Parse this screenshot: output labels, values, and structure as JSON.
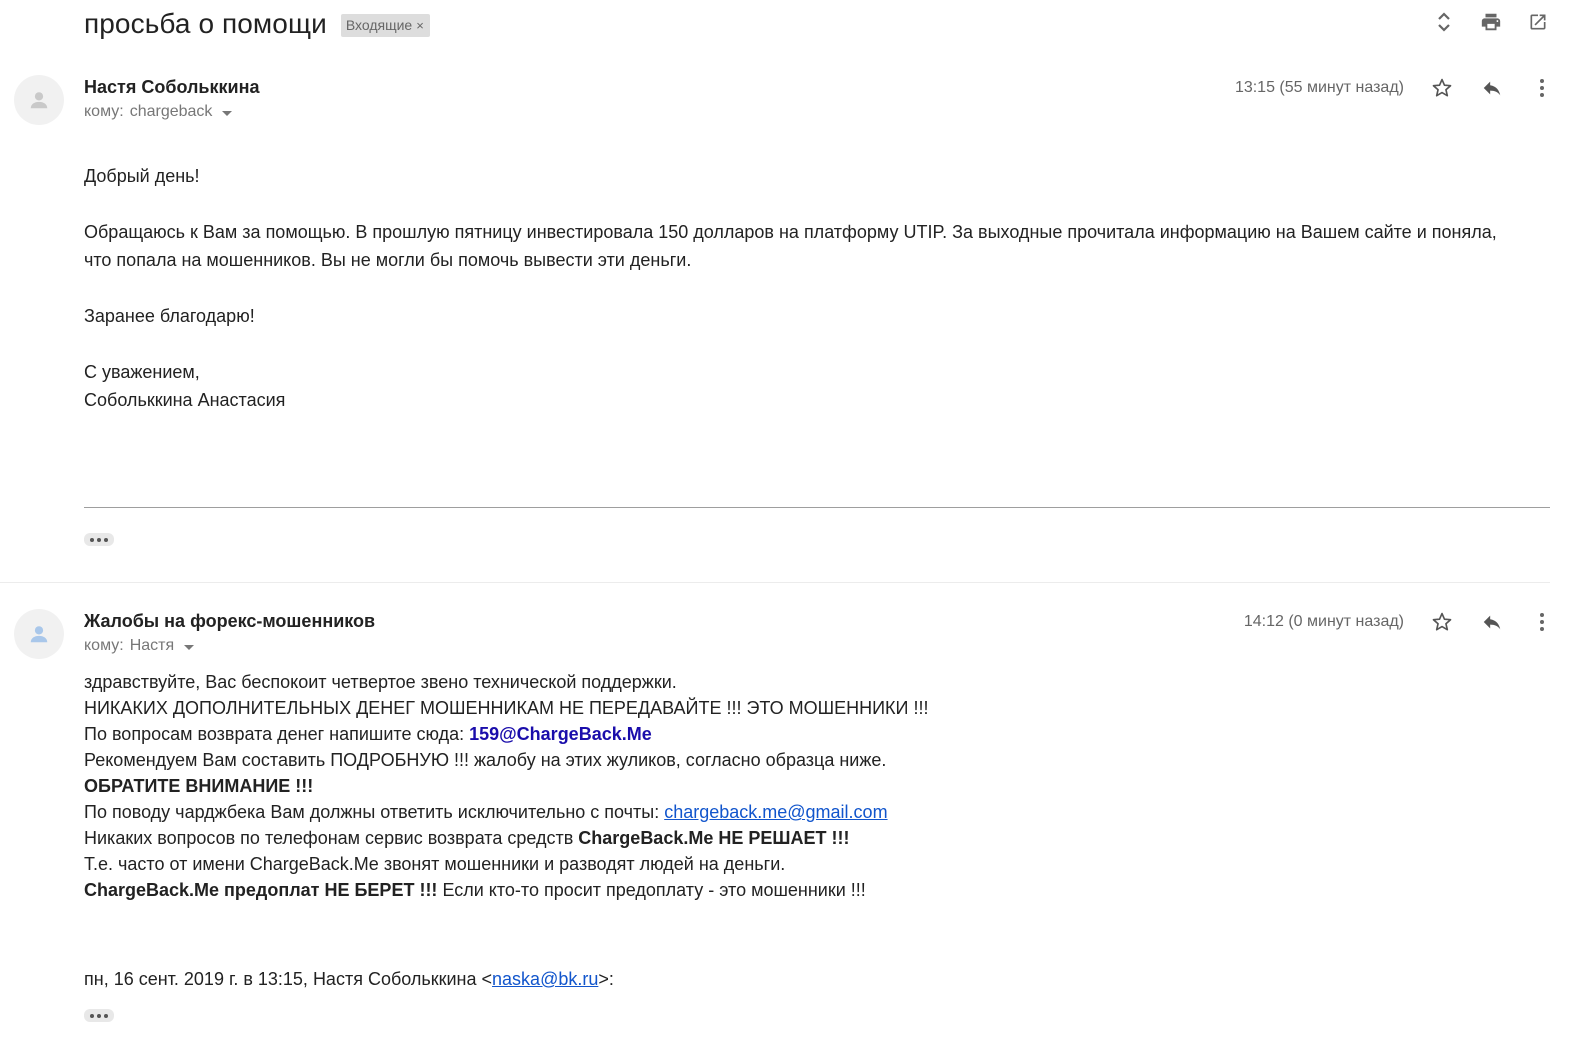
{
  "thread": {
    "subject": "просьба о помощи",
    "label": "Входящие",
    "label_remove": "×"
  },
  "toolbar": {
    "icons": [
      "expand-collapse-icon",
      "print-icon",
      "open-new-window-icon"
    ]
  },
  "message1": {
    "sender": "Настя Собольккина",
    "recipient_prefix": "кому:",
    "recipient": "chargeback",
    "time": "13:15 (55 минут назад)",
    "body": {
      "greeting": "Добрый день!",
      "para1": "Обращаюсь к Вам за помощью. В прошлую пятницу инвестировала 150 долларов на платформу UTIP. За выходные прочитала информацию на Вашем сайте и поняла, что попала на мошенников. Вы не могли бы помочь вывести эти деньги.",
      "thanks": "Заранее благодарю!",
      "regards": "С уважением,",
      "signature": "Собольккина Анастасия"
    }
  },
  "message2": {
    "sender": "Жалобы на форекс-мошенников",
    "recipient_prefix": "кому:",
    "recipient": "Настя",
    "time": "14:12 (0 минут назад)",
    "body": {
      "line1": "здравствуйте, Вас беспокоит четвертое звено технической поддержки.",
      "line2": "НИКАКИХ ДОПОЛНИТЕЛЬНЫХ ДЕНЕГ МОШЕННИКАМ НЕ ПЕРЕДАВАЙТЕ !!! ЭТО МОШЕННИКИ !!!",
      "line3_prefix": "По вопросам возврата денег напишите сюда: ",
      "line3_email": "159@ChargeBack.Me",
      "line4": "Рекомендуем Вам составить ПОДРОБНУЮ !!! жалобу на этих жуликов, согласно образца ниже.",
      "line5": "ОБРАТИТЕ ВНИМАНИЕ !!!",
      "line6_prefix": "По поводу чарджбека Вам должны ответить исключительно с почты: ",
      "line6_link": "chargeback.me@gmail.com",
      "line7_prefix": "Никаких вопросов по телефонам сервис возврата средств ",
      "line7_bold": "ChargeBack.Me НЕ РЕШАЕТ !!!",
      "line8": "Т.е. часто от имени ChargeBack.Me звонят мошенники и разводят людей на деньги.",
      "line9_bold": "ChargeBack.Me предоплат НЕ БЕРЕТ !!!",
      "line9_rest": " Если кто-то просит предоплату - это мошенники !!!"
    },
    "quote": {
      "prefix": "пн, 16 сент. 2019 г. в 13:15, Настя Собольккина <",
      "email": "naska@bk.ru",
      "suffix": ">:"
    }
  }
}
